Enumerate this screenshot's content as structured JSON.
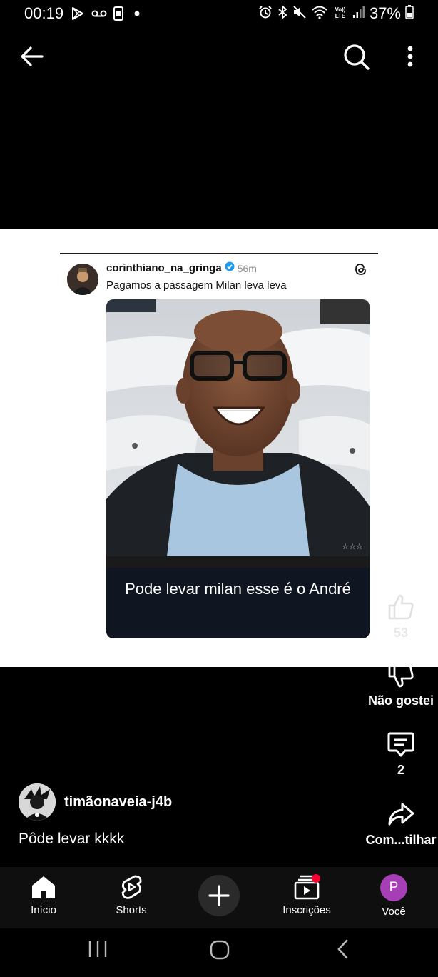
{
  "status_bar": {
    "time": "00:19",
    "battery_percent": "37%",
    "left_icons": [
      "play-store-icon",
      "voicemail-icon",
      "sim-icon",
      "dot-icon"
    ],
    "right_icons": [
      "alarm-icon",
      "bluetooth-icon",
      "mute-icon",
      "wifi-icon",
      "volte-icon",
      "signal-icon",
      "battery-icon"
    ],
    "volte_text": "Vo)) LTE"
  },
  "top_bar": {
    "icons": [
      "back-arrow-icon",
      "search-icon",
      "more-vertical-icon"
    ]
  },
  "video": {
    "post": {
      "username": "corinthiano_na_gringa",
      "time_ago": "56m",
      "caption": "Pagamos a passagem Milan leva leva",
      "verified_icon": "verified-badge-icon",
      "app_icon": "threads-icon"
    },
    "meme_caption": "Pode levar milan esse é o André"
  },
  "actions": {
    "like_count": "53",
    "dislike_label": "Não gostei",
    "comment_count": "2",
    "share_label": "Com...tilhar"
  },
  "channel": {
    "name": "timãonaveia-j4b",
    "title": "Pôde levar kkkk"
  },
  "bottom_nav": {
    "items": [
      {
        "label": "Início",
        "icon": "home-icon"
      },
      {
        "label": "Shorts",
        "icon": "shorts-icon"
      },
      {
        "label": "",
        "icon": "plus-icon"
      },
      {
        "label": "Inscrições",
        "icon": "subscriptions-icon"
      },
      {
        "label": "Você",
        "icon": "avatar-icon"
      }
    ],
    "you_initial": "P",
    "notification_color": "#ff0033",
    "avatar_color": "#a63fb5"
  },
  "system_nav": {
    "icons": [
      "recents-icon",
      "home-circle-icon",
      "back-chevron-icon"
    ]
  }
}
